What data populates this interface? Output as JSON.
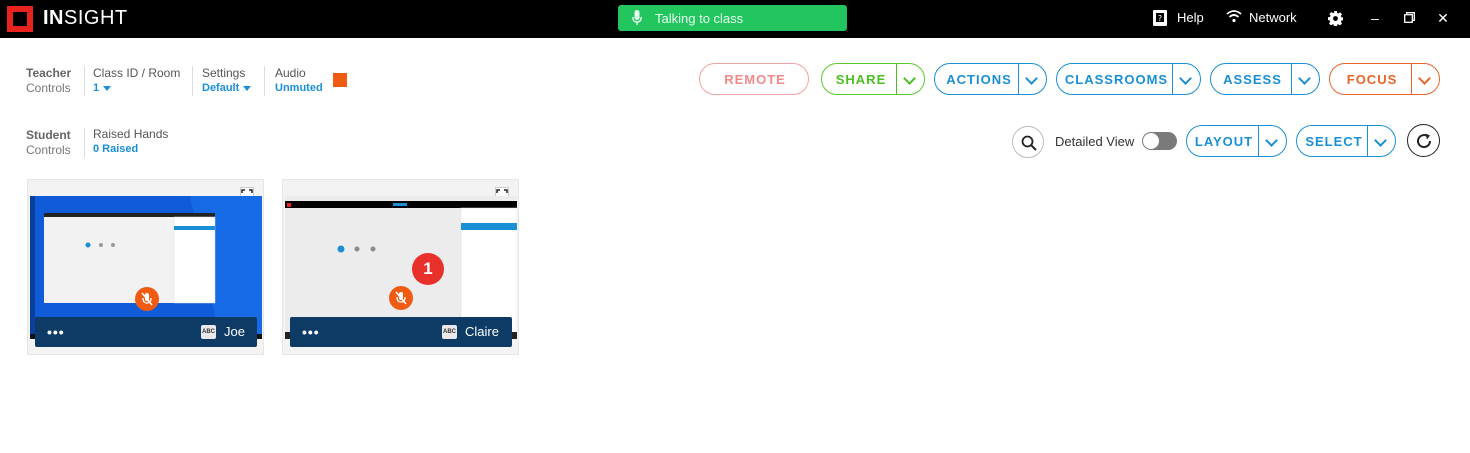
{
  "titlebar": {
    "logo_bold": "IN",
    "logo_rest": "SIGHT",
    "status": "Talking to class",
    "help": "Help",
    "network": "Network"
  },
  "teacher_controls": {
    "label": "Teacher",
    "sub": "Controls",
    "class_label": "Class ID / Room",
    "class_value": "1",
    "settings_label": "Settings",
    "settings_value": "Default",
    "audio_label": "Audio",
    "audio_value": "Unmuted"
  },
  "student_controls": {
    "label": "Student",
    "sub": "Controls",
    "hands_label": "Raised Hands",
    "hands_value": "0 Raised"
  },
  "buttons": {
    "remote": "REMOTE",
    "share": "SHARE",
    "actions": "ACTIONS",
    "classrooms": "CLASSROOMS",
    "assess": "ASSESS",
    "focus": "FOCUS",
    "detailed_view": "Detailed View",
    "layout": "LAYOUT",
    "select": "SELECT"
  },
  "students": [
    {
      "name": "Joe",
      "tag": "ABC",
      "raised_hands": ""
    },
    {
      "name": "Claire",
      "tag": "ABC",
      "raised_hands": "1"
    }
  ],
  "colors": {
    "accent_blue": "#1a8fd6",
    "share_green": "#4cbf22",
    "focus_orange": "#e8642a",
    "remote_red": "#e88a8a",
    "talk_green": "#22c55e"
  }
}
